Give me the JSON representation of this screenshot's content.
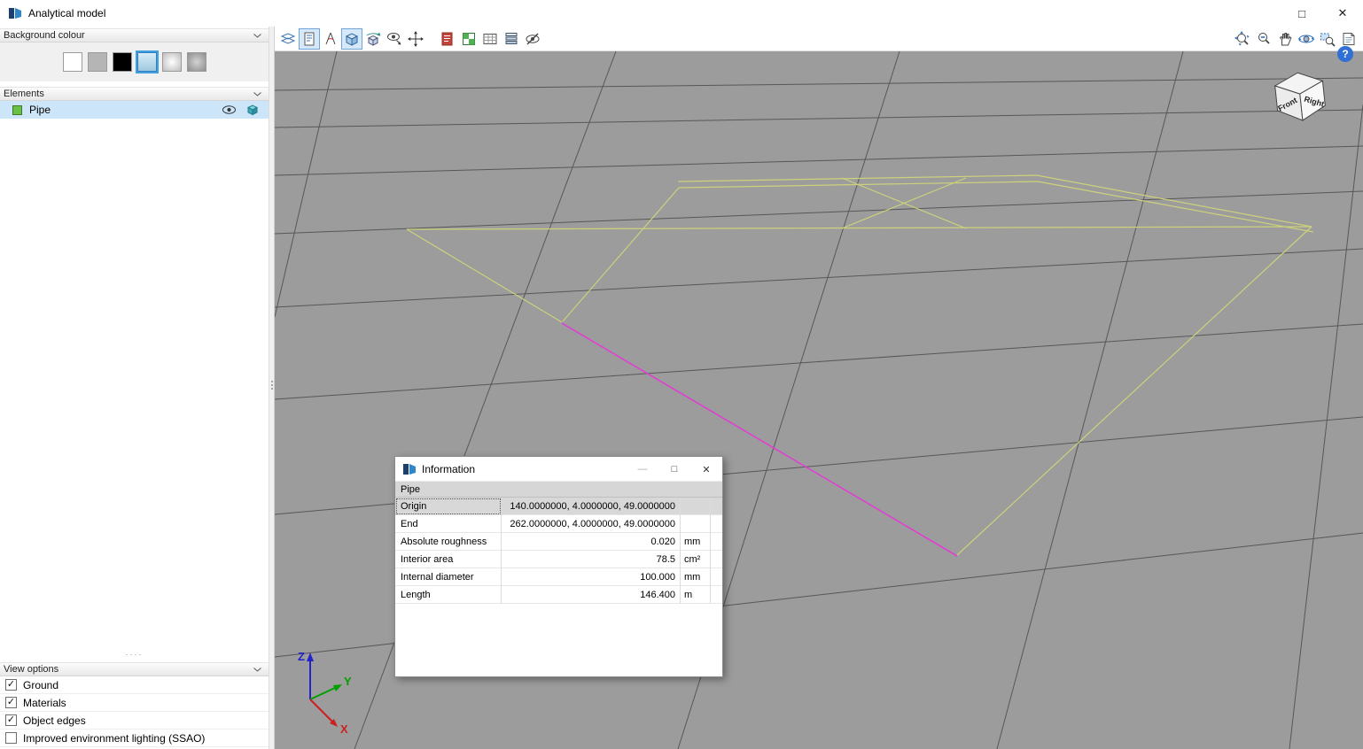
{
  "window": {
    "title": "Analytical model",
    "controls": {
      "maximize": "□",
      "close": "✕"
    }
  },
  "sidebar": {
    "background": {
      "title": "Background colour",
      "swatches": [
        {
          "name": "white",
          "color": "#ffffff",
          "selected": false
        },
        {
          "name": "grey",
          "color": "#b5b5b5",
          "selected": false
        },
        {
          "name": "black",
          "color": "#000000",
          "selected": false
        },
        {
          "name": "light-blue",
          "color": "#bcdcee",
          "selected": true
        },
        {
          "name": "grey-gradient",
          "color": "#e0e0e0",
          "selected": false
        },
        {
          "name": "dark-grey-gradient",
          "color": "#a8a8a8",
          "selected": false
        }
      ]
    },
    "elements": {
      "title": "Elements",
      "items": [
        {
          "label": "Pipe",
          "color": "#6abf45"
        }
      ]
    },
    "view_options": {
      "title": "View options",
      "options": [
        {
          "label": "Ground",
          "checked": true,
          "mark": "✓"
        },
        {
          "label": "Materials",
          "checked": true,
          "mark": "✓"
        },
        {
          "label": "Object edges",
          "checked": true,
          "mark": "✓"
        },
        {
          "label": "Improved environment lighting (SSAO)",
          "checked": false,
          "mark": ""
        }
      ]
    }
  },
  "toolbar": {
    "left_icons": [
      "clip-planes",
      "drawing-sheet",
      "measure-angle",
      "shaded-cube",
      "orbit-cube",
      "visibility-cursor",
      "move",
      "report",
      "materials",
      "data-table",
      "layer-stack",
      "hide-eye"
    ],
    "right_icons": [
      "zoom-extents",
      "zoom-out",
      "pan-hand",
      "orbit",
      "zoom-window",
      "guide-book"
    ]
  },
  "viewport": {
    "help_label": "?",
    "view_cube": {
      "front": "Front",
      "right": "Right"
    },
    "axes": {
      "x": "X",
      "y": "Y",
      "z": "Z"
    },
    "colors": {
      "ground": "#9c9c9c",
      "grid": "#4c4c4c",
      "pipe": "#cdd17c",
      "selected_pipe": "#df3fd2"
    }
  },
  "info_dialog": {
    "title": "Information",
    "controls": {
      "minimize": "—",
      "maximize": "□",
      "close": "✕"
    },
    "header": "Pipe",
    "rows": [
      {
        "label": "Origin",
        "value": "140.0000000, 4.0000000, 49.0000000",
        "unit": ""
      },
      {
        "label": "End",
        "value": "262.0000000, 4.0000000, 49.0000000",
        "unit": ""
      },
      {
        "label": "Absolute roughness",
        "value": "0.020",
        "unit": "mm"
      },
      {
        "label": "Interior area",
        "value": "78.5",
        "unit": "cm²"
      },
      {
        "label": "Internal diameter",
        "value": "100.000",
        "unit": "mm"
      },
      {
        "label": "Length",
        "value": "146.400",
        "unit": "m"
      }
    ]
  }
}
